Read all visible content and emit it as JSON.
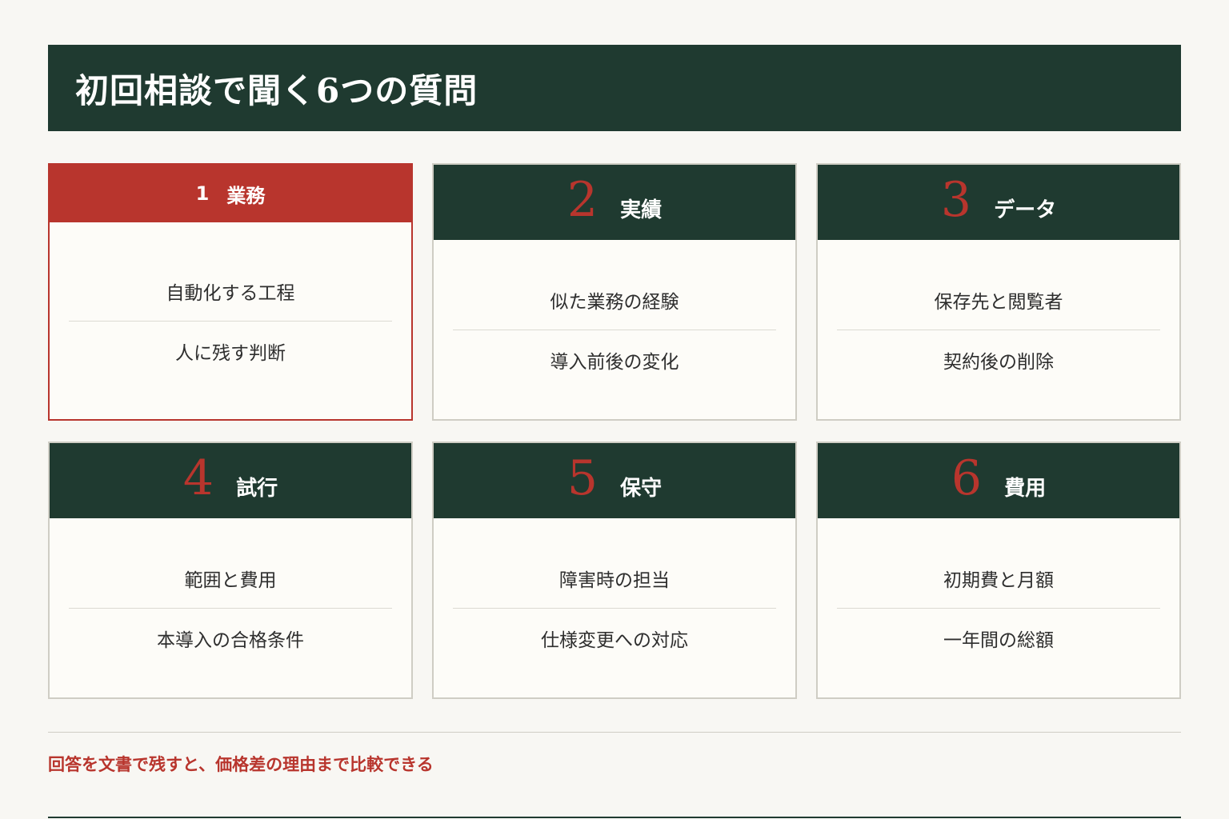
{
  "title": "初回相談で聞く6つの質問",
  "cards": [
    {
      "number": "1",
      "label": "業務",
      "items": [
        "自動化する工程",
        "人に残す判断"
      ]
    },
    {
      "number": "2",
      "label": "実績",
      "items": [
        "似た業務の経験",
        "導入前後の変化"
      ]
    },
    {
      "number": "3",
      "label": "データ",
      "items": [
        "保存先と閲覧者",
        "契約後の削除"
      ]
    },
    {
      "number": "4",
      "label": "試行",
      "items": [
        "範囲と費用",
        "本導入の合格条件"
      ]
    },
    {
      "number": "5",
      "label": "保守",
      "items": [
        "障害時の担当",
        "仕様変更への対応"
      ]
    },
    {
      "number": "6",
      "label": "費用",
      "items": [
        "初期費と月額",
        "一年間の総額"
      ]
    }
  ],
  "footer_note": "回答を文書で残すと、価格差の理由まで比較できる",
  "colors": {
    "dark_green": "#1f3a30",
    "accent_red": "#b8352d",
    "background": "#f8f7f3"
  }
}
